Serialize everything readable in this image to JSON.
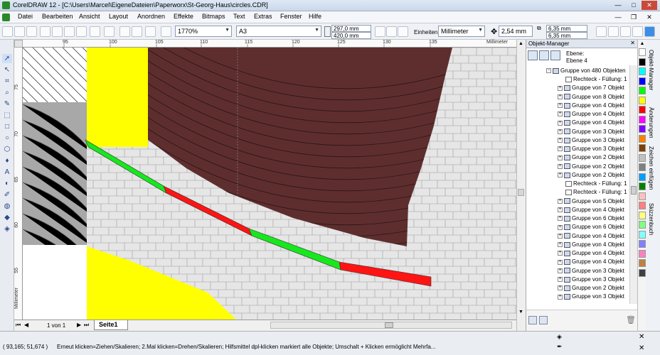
{
  "window": {
    "title": "CorelDRAW 12 - [C:\\Users\\Marcel\\EigeneDateien\\Paperworx\\St-Georg-Haus\\circles.CDR]"
  },
  "menu": [
    "Datei",
    "Bearbeiten",
    "Ansicht",
    "Layout",
    "Anordnen",
    "Effekte",
    "Bitmaps",
    "Text",
    "Extras",
    "Fenster",
    "Hilfe"
  ],
  "toolbar": {
    "zoom": "1770%",
    "paper": "A3",
    "width": "297,0 mm",
    "height": "420,0 mm",
    "units_label": "Einheiten:",
    "units_value": "Millimeter",
    "nudge": "2,54 mm",
    "dup_x": "6,35 mm",
    "dup_y": "6,35 mm"
  },
  "ruler": {
    "h_ticks": [
      "95",
      "100",
      "105",
      "110",
      "115",
      "120",
      "125",
      "130",
      "135"
    ],
    "h_unit": "Millimeter",
    "v_ticks": [
      "75",
      "70",
      "65",
      "60",
      "55"
    ],
    "v_unit": "Millimeter"
  },
  "pagebar": {
    "page_count": "1 von 1",
    "page_tab": "Seite1"
  },
  "status": {
    "coords": "( 93,165; 51,674 )",
    "hint": "Erneut klicken=Ziehen/Skalieren; 2.Mal klicken=Drehen/Skalieren; Hilfsmittel dpl-klicken markiert alle Objekte; Umschalt + Klicken ermöglicht Mehrfa..."
  },
  "panel": {
    "title": "Objekt-Manager",
    "layer_label": "Ebene:",
    "layer_value": "Ebene 4",
    "top_group": "Gruppe von 480 Objekten",
    "items": [
      {
        "label": "Rechteck - Füllung: 1",
        "kind": "rect"
      },
      {
        "label": "Gruppe von 7 Objekt",
        "kind": "group"
      },
      {
        "label": "Gruppe von 8 Objekt",
        "kind": "group"
      },
      {
        "label": "Gruppe von 4 Objekt",
        "kind": "group"
      },
      {
        "label": "Gruppe von 4 Objekt",
        "kind": "group"
      },
      {
        "label": "Gruppe von 4 Objekt",
        "kind": "group"
      },
      {
        "label": "Gruppe von 3 Objekt",
        "kind": "group"
      },
      {
        "label": "Gruppe von 3 Objekt",
        "kind": "group"
      },
      {
        "label": "Gruppe von 3 Objekt",
        "kind": "group"
      },
      {
        "label": "Gruppe von 2 Objekt",
        "kind": "group"
      },
      {
        "label": "Gruppe von 2 Objekt",
        "kind": "group"
      },
      {
        "label": "Gruppe von 2 Objekt",
        "kind": "group"
      },
      {
        "label": "Rechteck - Füllung: 1",
        "kind": "rect"
      },
      {
        "label": "Rechteck - Füllung: 1",
        "kind": "rect"
      },
      {
        "label": "Gruppe von 5 Objekt",
        "kind": "group"
      },
      {
        "label": "Gruppe von 4 Objekt",
        "kind": "group"
      },
      {
        "label": "Gruppe von 6 Objekt",
        "kind": "group"
      },
      {
        "label": "Gruppe von 6 Objekt",
        "kind": "group"
      },
      {
        "label": "Gruppe von 4 Objekt",
        "kind": "group"
      },
      {
        "label": "Gruppe von 4 Objekt",
        "kind": "group"
      },
      {
        "label": "Gruppe von 4 Objekt",
        "kind": "group"
      },
      {
        "label": "Gruppe von 4 Objekt",
        "kind": "group"
      },
      {
        "label": "Gruppe von 3 Objekt",
        "kind": "group"
      },
      {
        "label": "Gruppe von 3 Objekt",
        "kind": "group"
      },
      {
        "label": "Gruppe von 2 Objekt",
        "kind": "group"
      },
      {
        "label": "Gruppe von 3 Objekt",
        "kind": "group"
      }
    ]
  },
  "palette": [
    "#ffffff",
    "#000000",
    "#00ffff",
    "#0000ff",
    "#00ff00",
    "#ffff00",
    "#ff0000",
    "#ff00ff",
    "#8000ff",
    "#ff8000",
    "#804000",
    "#c0c0c0",
    "#808080",
    "#00a0ff",
    "#008000",
    "#ffc0c0",
    "#ff8080",
    "#ffff80",
    "#80ff80",
    "#80ffff",
    "#8080ff",
    "#ff80c0",
    "#c08040",
    "#404040"
  ],
  "dockers": [
    "Objekt-Manager",
    "Änderungen",
    "Zeichen einfügen",
    "Skizzenbuch"
  ],
  "colors": {
    "brown": "#5e2e2e",
    "tile": "#e6e6e6",
    "green": "#16e81c",
    "red": "#ff1414",
    "yellow": "#ffff00",
    "gray": "#a8a8a8"
  }
}
